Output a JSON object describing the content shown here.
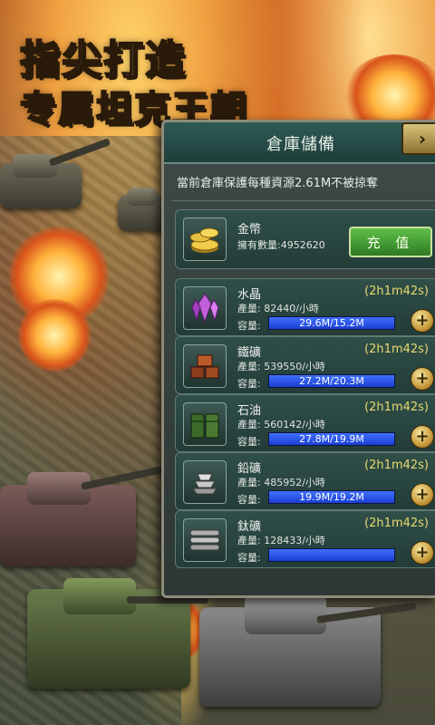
{
  "promo": {
    "headline_line1": "指尖打造",
    "headline_line2": "专属坦克王朝"
  },
  "dialog": {
    "title": "倉庫儲備",
    "close_icon": "chevron-right-icon",
    "notice": "當前倉庫保護每種資源2.61M不被掠奪",
    "gold": {
      "name": "金幣",
      "owned_label": "擁有數量:4952620",
      "topup_label": "充 值",
      "icon": "gold-coins-icon"
    },
    "resources": [
      {
        "name": "水晶",
        "rate": "產量: 82440/小時",
        "cap_label": "容量:",
        "capacity": "29.6M/15.2M",
        "fill": 1.0,
        "timer": "(2h1m42s)",
        "icon": "crystal-icon"
      },
      {
        "name": "鐵礦",
        "rate": "產量: 539550/小時",
        "cap_label": "容量:",
        "capacity": "27.2M/20.3M",
        "fill": 1.0,
        "timer": "(2h1m42s)",
        "icon": "iron-ore-icon"
      },
      {
        "name": "石油",
        "rate": "產量: 560142/小時",
        "cap_label": "容量:",
        "capacity": "27.8M/19.9M",
        "fill": 1.0,
        "timer": "(2h1m42s)",
        "icon": "oil-barrel-icon"
      },
      {
        "name": "鉛礦",
        "rate": "產量: 485952/小時",
        "cap_label": "容量:",
        "capacity": "19.9M/19.2M",
        "fill": 1.0,
        "timer": "(2h1m42s)",
        "icon": "lead-ingot-icon"
      },
      {
        "name": "鈦礦",
        "rate": "產量: 128433/小時",
        "cap_label": "容量:",
        "capacity": "",
        "fill": 1.0,
        "timer": "(2h1m42s)",
        "icon": "titanium-pipe-icon"
      }
    ]
  }
}
